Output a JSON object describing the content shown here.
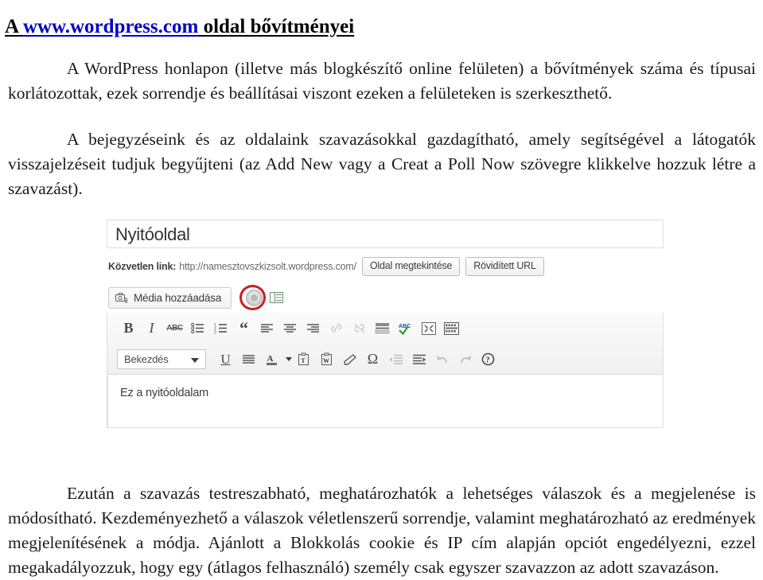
{
  "document": {
    "heading": {
      "prefix": "A ",
      "link": "www.wordpress.com",
      "suffix": " oldal bővítményei"
    },
    "paragraphs": {
      "intro": "A WordPress honlapon (illetve más blogkészítő online felületen) a bővítmények száma és típusai korlátozottak, ezek sorrendje és beállításai viszont ezeken a felületeken is szerkeszthető.",
      "polls": "A bejegyzéseink és az oldalaink szavazásokkal gazdagítható, amely segítségével a látogatók visszajelzéseit tudjuk begyűjteni (az Add New vagy a Creat a Poll Now szövegre klikkelve hozzuk létre a szavazást).",
      "customize": "Ezután a szavazás testreszabható, meghatározhatók a lehetséges válaszok és a megjelenése is módosítható. Kezdeményezhető a válaszok véletlenszerű sorrendje, valamint meghatározható az eredmények megjelenítésének a módja. Ajánlott a Blokkolás cookie és IP cím alapján opciót engedélyezni, ezzel megakadályozzuk, hogy egy (átlagos felhasználó) személy csak egyszer szavazzon az adott szavazáson."
    }
  },
  "screenshot": {
    "title_field": {
      "value": "Nyitóoldal"
    },
    "permalink": {
      "label": "Közvetlen link:",
      "url": "http://namesztovszkizsolt.wordpress.com/",
      "view_button": "Oldal megtekintése",
      "shorten_button": "Rövidített URL"
    },
    "media": {
      "add_media_label": "Média hozzáadása",
      "camera_icon": "camera-icon",
      "poll_icon": "poll-circle-icon",
      "form_icon": "form-table-icon",
      "highlight_color": "#cc1c22"
    },
    "toolbar": {
      "row1": [
        {
          "name": "bold-icon",
          "glyph": "B",
          "kind": "b",
          "dim": false
        },
        {
          "name": "italic-icon",
          "glyph": "I",
          "kind": "i",
          "dim": false
        },
        {
          "name": "strikethrough-icon",
          "glyph": "ABC",
          "kind": "strike",
          "dim": false
        },
        {
          "name": "bullet-list-icon",
          "glyph": "",
          "kind": "svg-ul",
          "dim": false
        },
        {
          "name": "numbered-list-icon",
          "glyph": "",
          "kind": "svg-ol",
          "dim": false
        },
        {
          "name": "blockquote-icon",
          "glyph": "“",
          "kind": "quote",
          "dim": false
        },
        {
          "name": "align-left-icon",
          "glyph": "",
          "kind": "svg-al",
          "dim": false
        },
        {
          "name": "align-center-icon",
          "glyph": "",
          "kind": "svg-ac",
          "dim": false
        },
        {
          "name": "align-right-icon",
          "glyph": "",
          "kind": "svg-ar",
          "dim": false
        },
        {
          "name": "insert-link-icon",
          "glyph": "",
          "kind": "svg-link",
          "dim": true
        },
        {
          "name": "unlink-icon",
          "glyph": "",
          "kind": "svg-unlink",
          "dim": true
        },
        {
          "name": "more-tag-icon",
          "glyph": "",
          "kind": "svg-more",
          "dim": false
        },
        {
          "name": "spellcheck-icon",
          "glyph": "",
          "kind": "svg-spell",
          "dim": false
        },
        {
          "name": "fullscreen-icon",
          "glyph": "",
          "kind": "svg-full",
          "dim": false
        },
        {
          "name": "kitchen-sink-icon",
          "glyph": "",
          "kind": "svg-sink",
          "dim": false
        }
      ],
      "paragraph_select": {
        "value": "Bekezdés",
        "caret_icon": "chevron-down-icon"
      },
      "row2": [
        {
          "name": "underline-icon",
          "glyph": "U",
          "kind": "u",
          "dim": false
        },
        {
          "name": "justify-icon",
          "glyph": "",
          "kind": "svg-aj",
          "dim": false
        },
        {
          "name": "text-color-icon",
          "glyph": "A",
          "kind": "svg-color",
          "dim": false
        },
        {
          "name": "paste-as-text-icon",
          "glyph": "",
          "kind": "svg-pastet",
          "dim": false
        },
        {
          "name": "paste-from-word-icon",
          "glyph": "",
          "kind": "svg-pastew",
          "dim": false
        },
        {
          "name": "remove-formatting-icon",
          "glyph": "",
          "kind": "svg-eraser",
          "dim": false
        },
        {
          "name": "special-character-icon",
          "glyph": "Ω",
          "kind": "omega",
          "dim": false
        },
        {
          "name": "outdent-icon",
          "glyph": "",
          "kind": "svg-outd",
          "dim": true
        },
        {
          "name": "indent-icon",
          "glyph": "",
          "kind": "svg-ind",
          "dim": false
        },
        {
          "name": "undo-icon",
          "glyph": "",
          "kind": "svg-undo",
          "dim": true
        },
        {
          "name": "redo-icon",
          "glyph": "",
          "kind": "svg-redo",
          "dim": true
        },
        {
          "name": "help-icon",
          "glyph": "",
          "kind": "svg-help",
          "dim": false
        }
      ]
    },
    "editor": {
      "content": "Ez a nyitóoldalam"
    }
  }
}
